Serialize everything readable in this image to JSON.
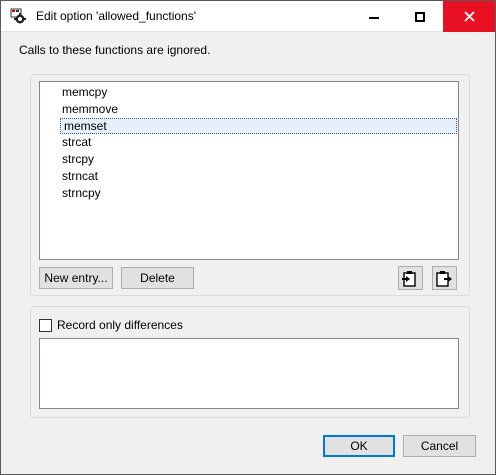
{
  "window": {
    "title": "Edit option 'allowed_functions'",
    "close_color": "#e81123"
  },
  "description": "Calls to these functions are ignored.",
  "list": {
    "items": [
      "memcpy",
      "memmove",
      "memset",
      "strcat",
      "strcpy",
      "strncat",
      "strncpy"
    ],
    "selected_index": 2
  },
  "buttons": {
    "new_entry": "New entry...",
    "delete": "Delete",
    "ok": "OK",
    "cancel": "Cancel"
  },
  "icons": {
    "import": "paste-import-icon",
    "export": "paste-export-icon"
  },
  "record_only_differences": {
    "label": "Record only differences",
    "checked": false
  },
  "notes_text": ""
}
